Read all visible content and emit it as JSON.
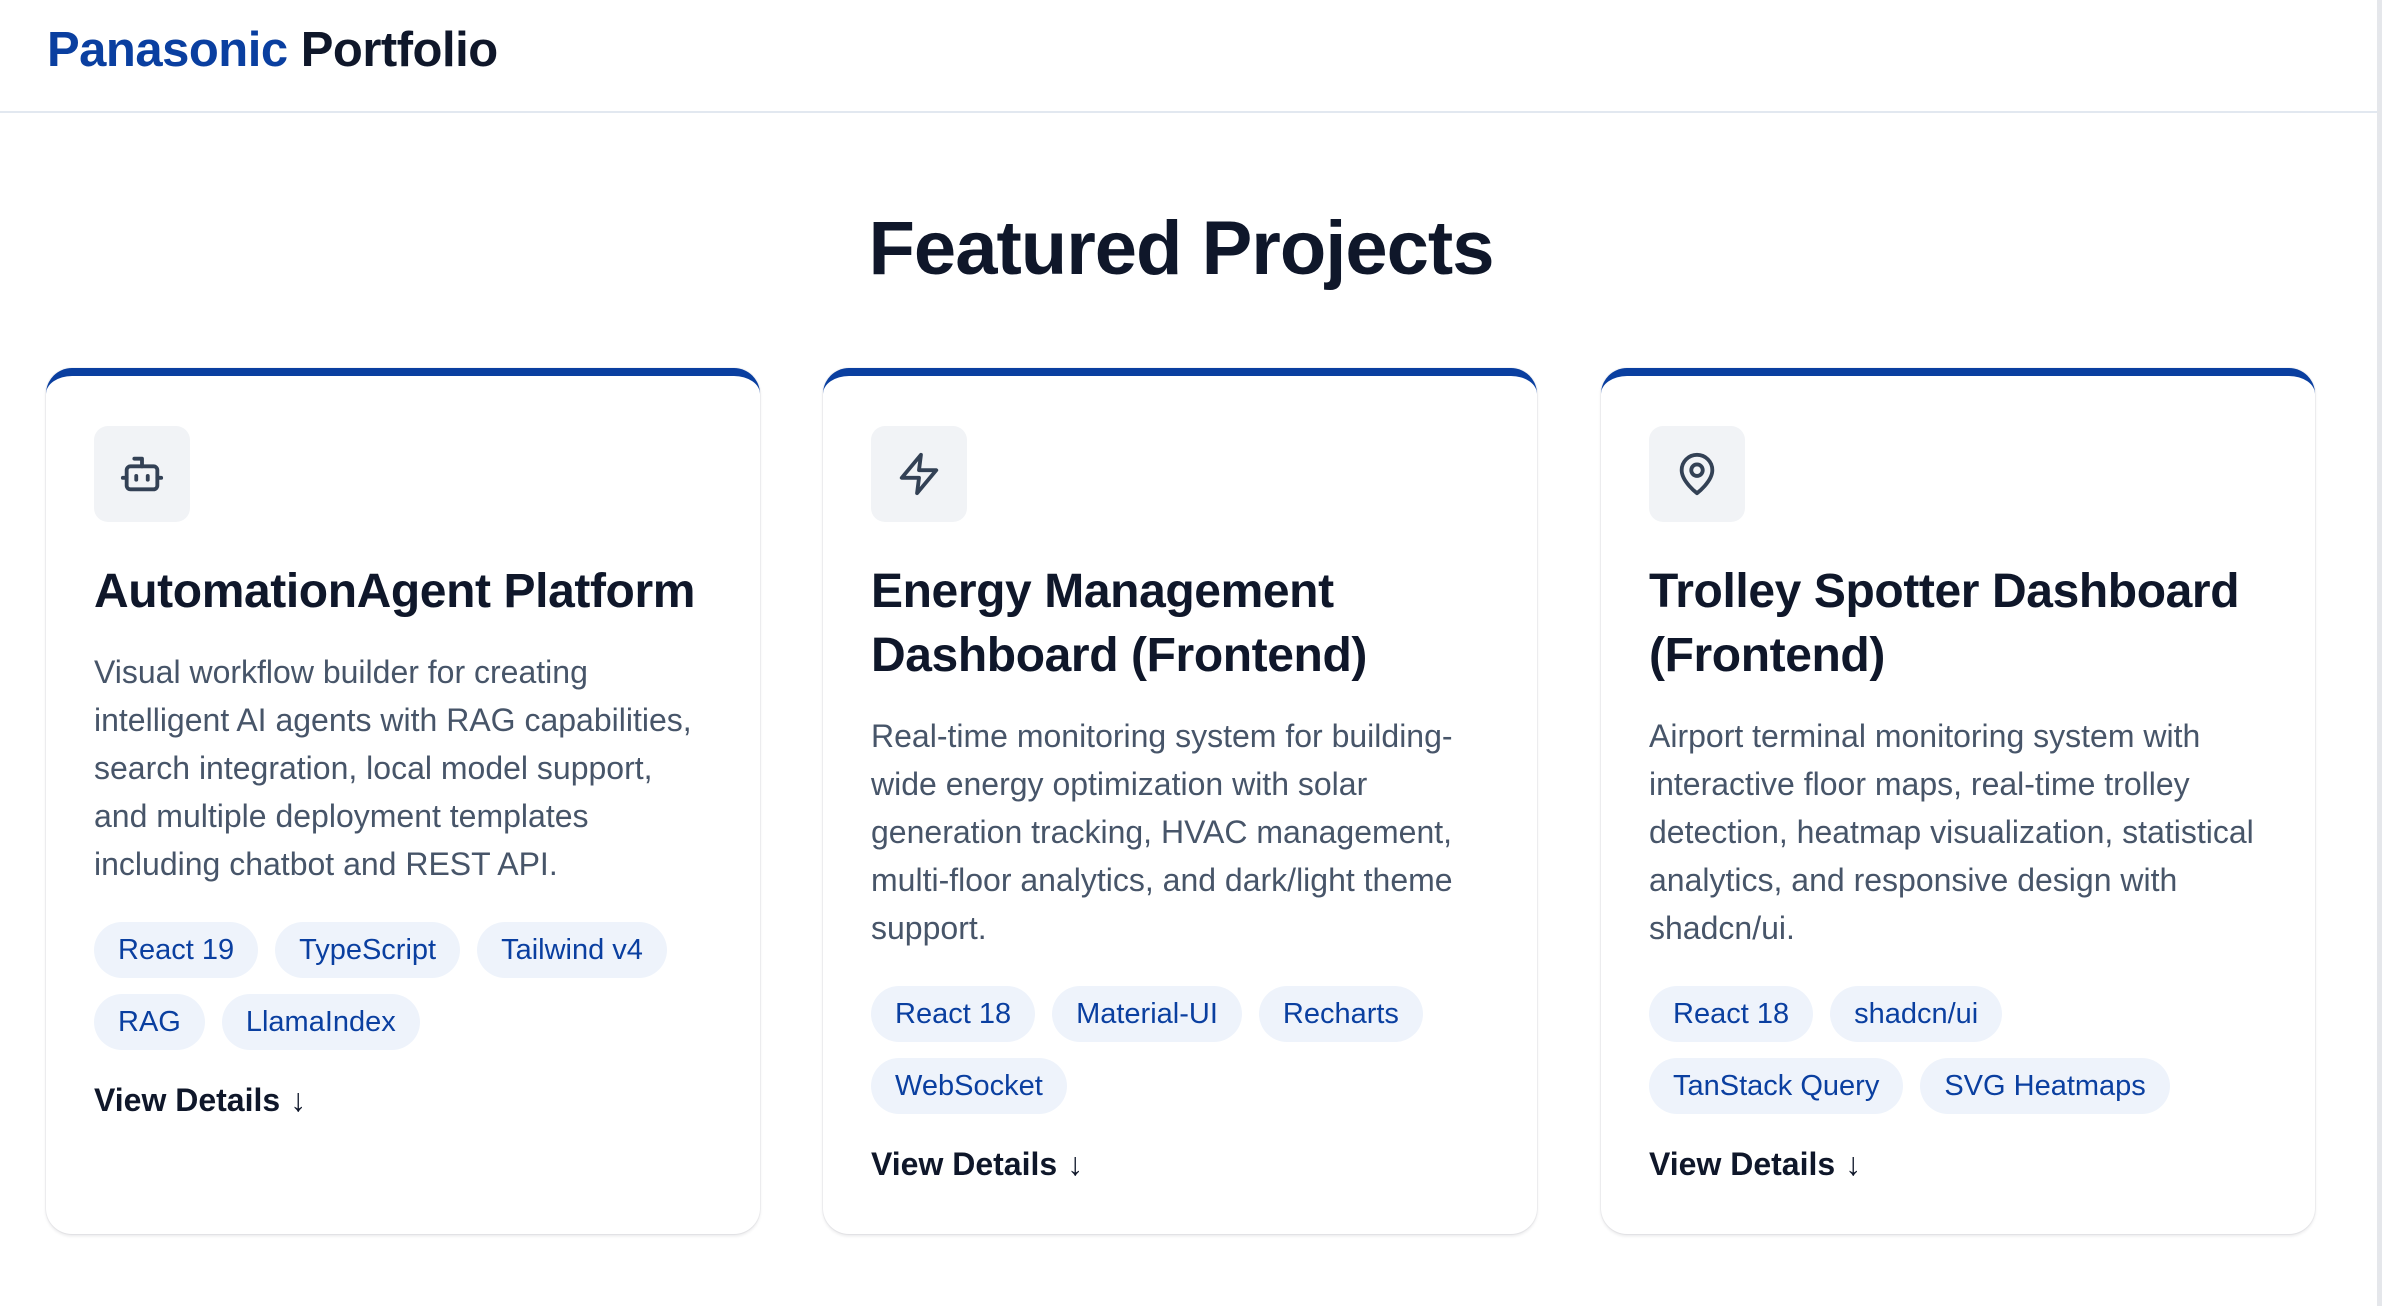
{
  "header": {
    "brand_primary": "Panasonic",
    "brand_secondary": "Portfolio"
  },
  "section": {
    "title": "Featured Projects"
  },
  "projects": [
    {
      "icon": "robot-icon",
      "title": "AutomationAgent Platform",
      "description": "Visual workflow builder for creating intelligent AI agents with RAG capabilities, search integration, local model support, and multiple deployment templates including chatbot and REST API.",
      "tags": [
        "React 19",
        "TypeScript",
        "Tailwind v4",
        "RAG",
        "LlamaIndex"
      ],
      "link_label": "View Details",
      "link_arrow": "↓"
    },
    {
      "icon": "lightning-icon",
      "title": "Energy Management Dashboard (Frontend)",
      "description": "Real-time monitoring system for building-wide energy optimization with solar generation tracking, HVAC management, multi-floor analytics, and dark/light theme support.",
      "tags": [
        "React 18",
        "Material-UI",
        "Recharts",
        "WebSocket"
      ],
      "link_label": "View Details",
      "link_arrow": "↓"
    },
    {
      "icon": "map-pin-icon",
      "title": "Trolley Spotter Dashboard (Frontend)",
      "description": "Airport terminal monitoring system with interactive floor maps, real-time trolley detection, heatmap visualization, statistical analytics, and responsive design with shadcn/ui.",
      "tags": [
        "React 18",
        "shadcn/ui",
        "TanStack Query",
        "SVG Heatmaps"
      ],
      "link_label": "View Details",
      "link_arrow": "↓"
    }
  ],
  "colors": {
    "brand_blue": "#0a3fa0",
    "heading": "#0f172a",
    "body_text": "#475569",
    "tag_bg": "#eef3fb"
  }
}
